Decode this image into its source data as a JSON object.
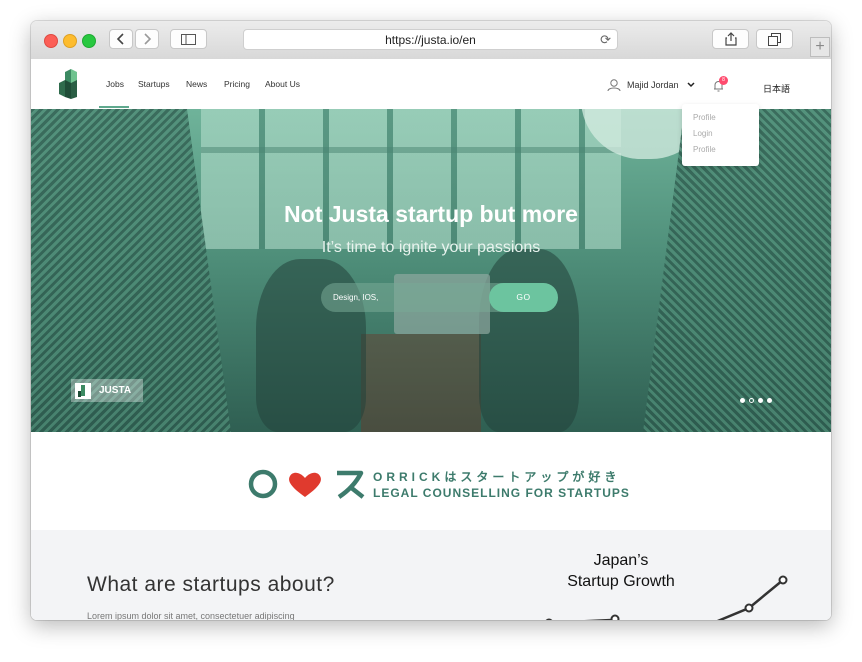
{
  "browser": {
    "url": "https://justa.io/en",
    "back_icon": "chevron-left-icon",
    "forward_icon": "chevron-right-icon",
    "sidebar_icon": "sidebar-icon",
    "reload_icon": "reload-icon",
    "share_icon": "share-icon",
    "tabs_icon": "tabs-icon",
    "new_tab_label": "+"
  },
  "nav": {
    "items": [
      {
        "label": "Jobs",
        "active": true
      },
      {
        "label": "Startups"
      },
      {
        "label": "News"
      },
      {
        "label": "Pricing"
      },
      {
        "label": "About Us"
      }
    ],
    "user_name": "Majid Jordan",
    "notification_count": "8",
    "language": "日本語",
    "accent_color": "#5fa98e"
  },
  "user_menu": {
    "items": [
      "Profile",
      "Login",
      "Profile"
    ]
  },
  "hero": {
    "title": "Not Justa startup but more",
    "subtitle": "It’s time to ignite your passions",
    "search_placeholder": "Design, IOS,",
    "go_label": "GO",
    "badge_label": "JUSTA",
    "slides_total": 4,
    "slide_active": 2
  },
  "sponsor": {
    "line1": "ORRICKはスタートアップが好き",
    "line2": "LEGAL COUNSELLING FOR STARTUPS",
    "brand_color": "#3d7b6c",
    "heart_color": "#e03a2e"
  },
  "about": {
    "title": "What are startups about?",
    "text": "Lorem ipsum dolor sit amet, consectetuer adipiscing"
  },
  "growth_chart": {
    "title_line1": "Japan’s",
    "title_line2": "Startup Growth"
  }
}
